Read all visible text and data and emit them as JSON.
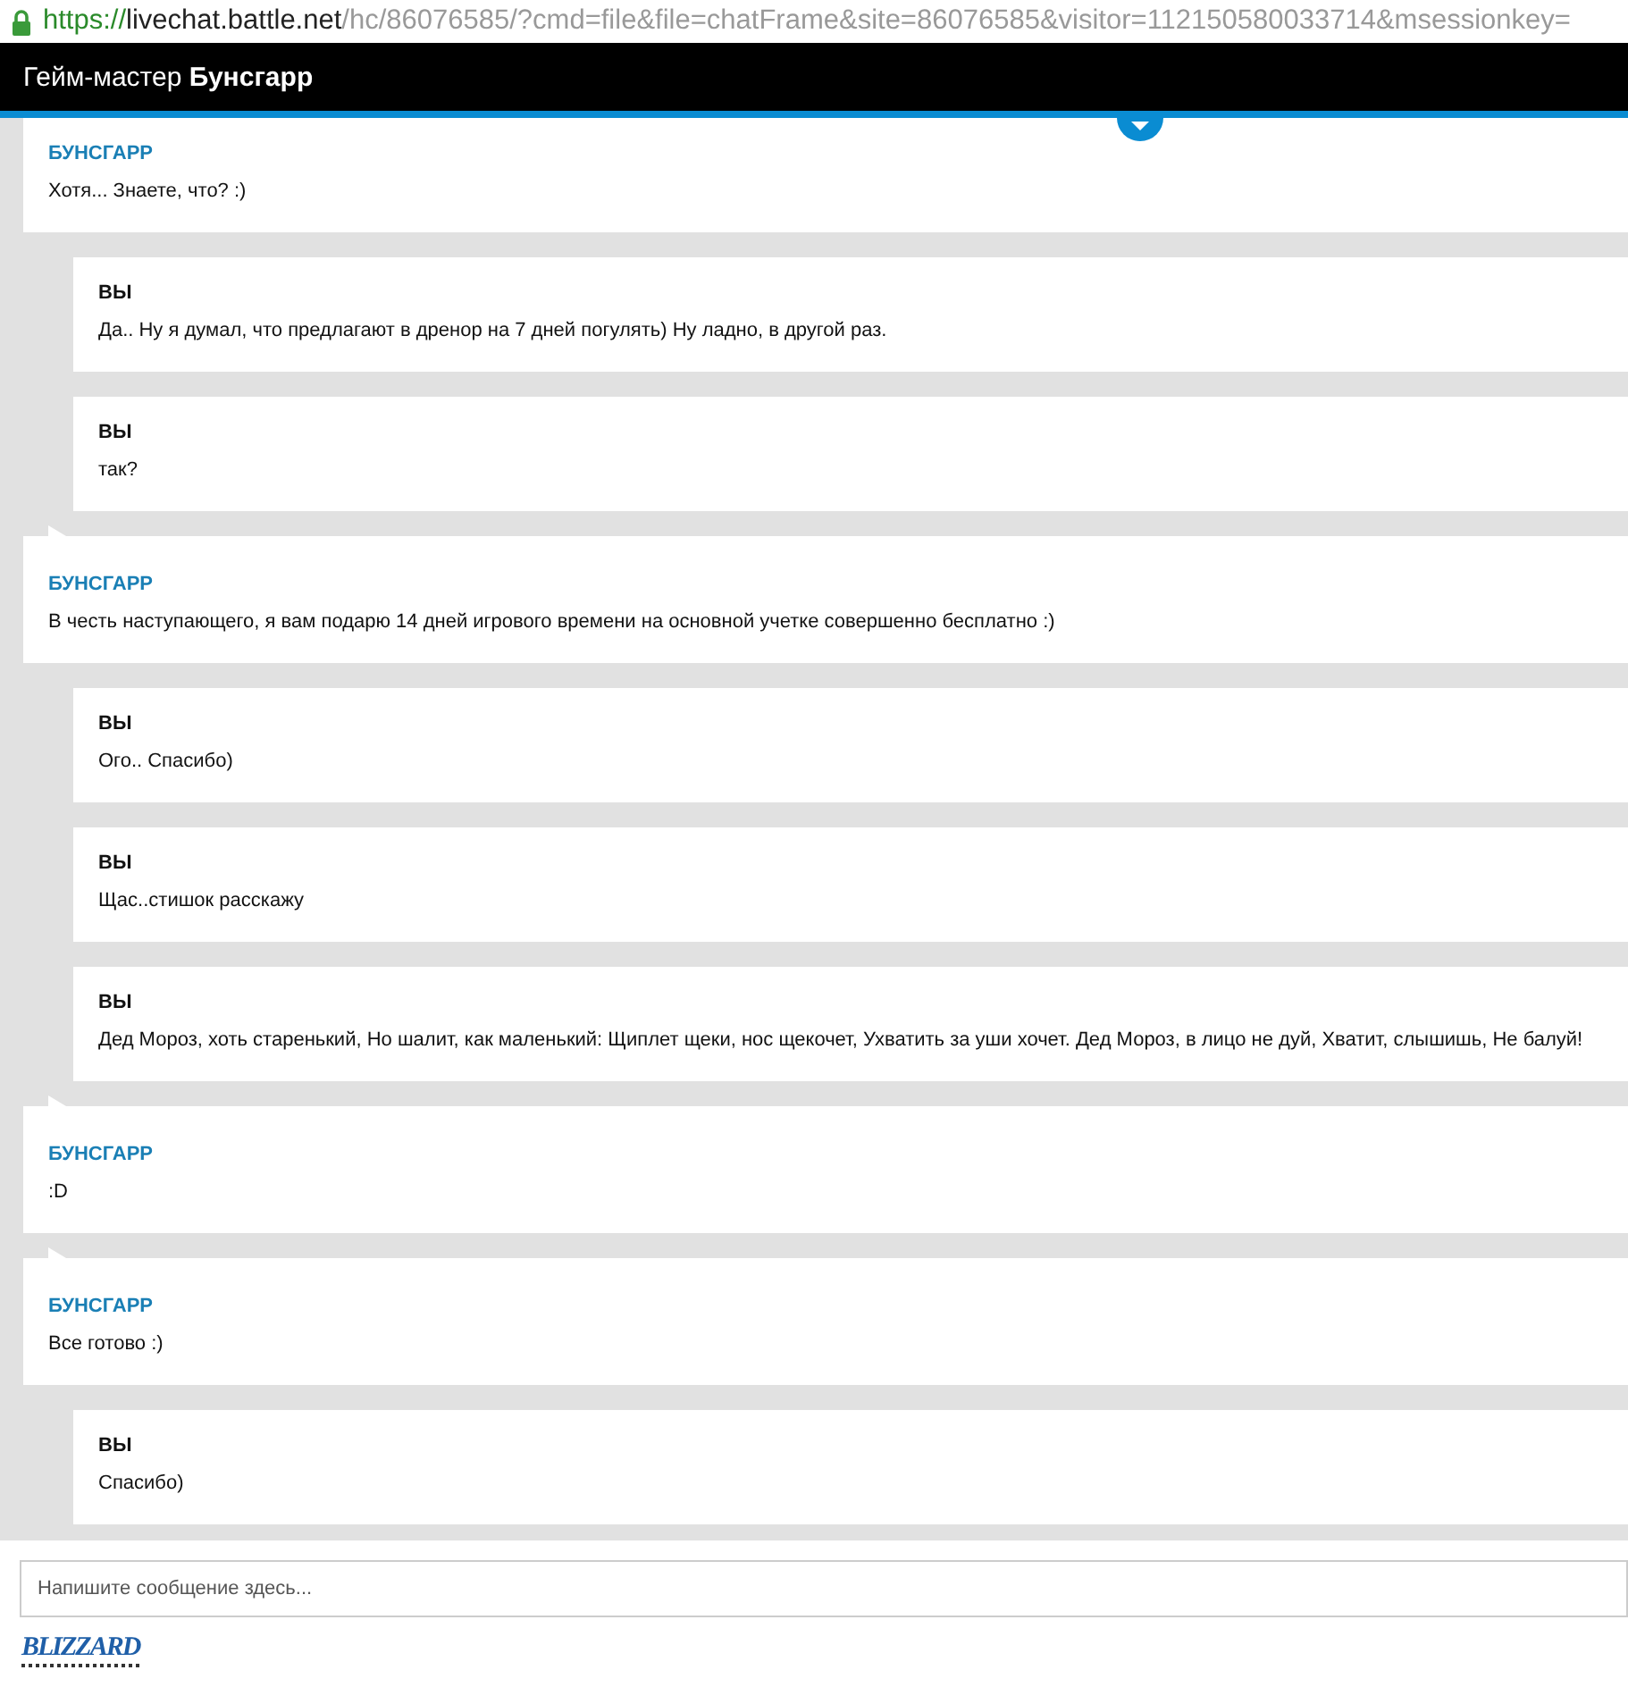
{
  "address_bar": {
    "secure": true,
    "scheme": "https://",
    "host": "livechat.battle.net",
    "path": "/hc/86076585/?cmd=file&file=chatFrame&site=86076585&visitor=112150580033714&msessionkey="
  },
  "header": {
    "role": "Гейм-мастер",
    "agent": "Бунсгарр"
  },
  "messages": [
    {
      "kind": "agent",
      "author": "БУНСГАРР",
      "text": "Хотя... Знаете, что? :)"
    },
    {
      "kind": "user",
      "author": "ВЫ",
      "text": "Да.. Ну я думал, что предлагают в дренор на 7 дней погулять) Ну ладно, в другой раз."
    },
    {
      "kind": "user",
      "author": "ВЫ",
      "text": "так?"
    },
    {
      "kind": "agent",
      "author": "БУНСГАРР",
      "text": "В честь наступающего, я вам подарю 14 дней игрового времени на основной учетке совершенно бесплатно :)"
    },
    {
      "kind": "user",
      "author": "ВЫ",
      "text": "Ого.. Спасибо)"
    },
    {
      "kind": "user",
      "author": "ВЫ",
      "text": "Щас..стишок расскажу"
    },
    {
      "kind": "user",
      "author": "ВЫ",
      "text": "Дед Мороз, хоть старенький, Но шалит, как маленький: Щиплет щеки, нос щекочет, Ухватить за уши хочет. Дед Мороз, в лицо не дуй, Хватит, слышишь, Не балуй!"
    },
    {
      "kind": "agent",
      "author": "БУНСГАРР",
      "text": ":D"
    },
    {
      "kind": "agent",
      "author": "БУНСГАРР",
      "text": "Все готово :)"
    },
    {
      "kind": "user",
      "author": "ВЫ",
      "text": "Спасибо)"
    }
  ],
  "composer": {
    "placeholder": "Напишите сообщение здесь..."
  },
  "footer": {
    "logo": "BLIZZARD"
  }
}
